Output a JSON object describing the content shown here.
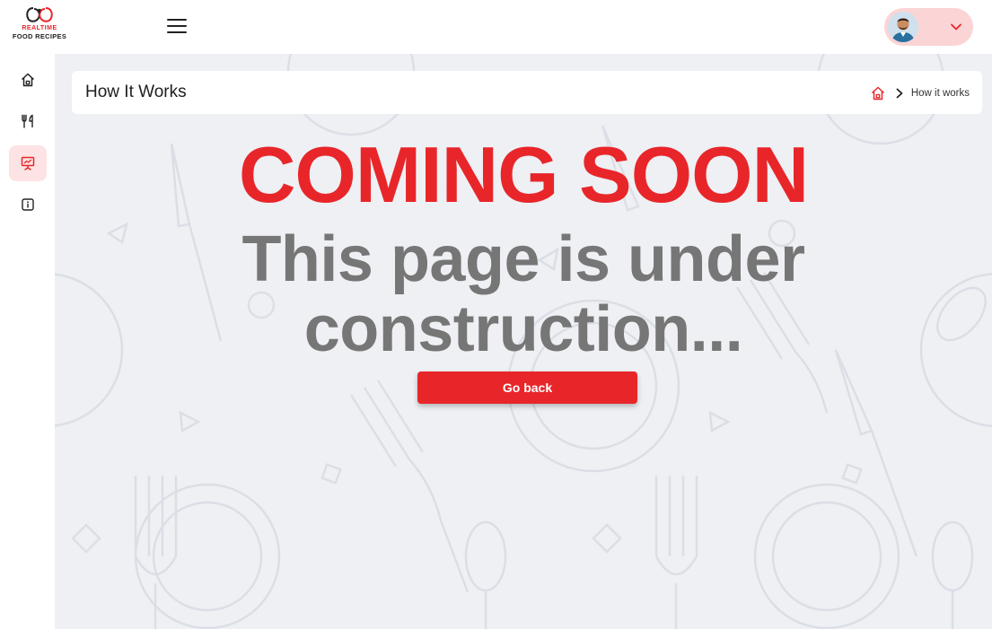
{
  "brand": {
    "line1": "REALTIME",
    "line2": "FOOD RECIPES",
    "accent_color": "#e8262a"
  },
  "header": {
    "menu_icon": "hamburger-icon",
    "profile_icon": "avatar",
    "dropdown_icon": "chevron-down-icon"
  },
  "sidebar": {
    "items": [
      {
        "icon": "home-icon",
        "active": false
      },
      {
        "icon": "fork-knife-icon",
        "active": false
      },
      {
        "icon": "presentation-icon",
        "active": true
      },
      {
        "icon": "info-icon",
        "active": false
      }
    ]
  },
  "page": {
    "title": "How It Works",
    "breadcrumb_current": "How it works"
  },
  "content": {
    "heading": "COMING SOON",
    "subheading_line1": "This page is under",
    "subheading_line2": "construction...",
    "button_label": "Go back"
  },
  "colors": {
    "primary": "#e8262a",
    "muted_text": "#767676",
    "background": "#eef0f4",
    "active_tab_bg": "#fde3e4"
  }
}
